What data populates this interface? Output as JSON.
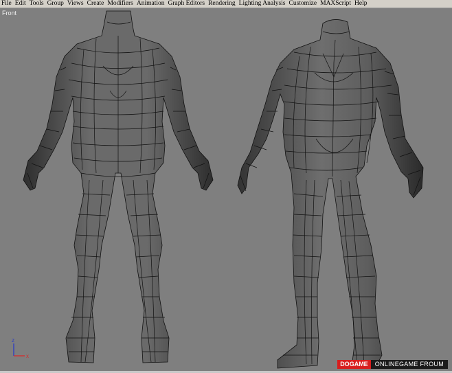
{
  "menu": {
    "items": [
      "File",
      "Edit",
      "Tools",
      "Group",
      "Views",
      "Create",
      "Modifiers",
      "Animation",
      "Graph Editors",
      "Rendering",
      "Lighting Analysis",
      "Customize",
      "MAXScript",
      "Help"
    ]
  },
  "viewport": {
    "label": "Front",
    "axes": {
      "z": "z",
      "x": "x"
    }
  },
  "watermark": {
    "brand": "DOGAME",
    "forum": "ONLINEGAME FROUM"
  },
  "colors": {
    "menubar": "#d4d0c8",
    "viewport_bg": "#7f7f7f",
    "mesh_fill": "#5a5a5a",
    "wire": "#111111",
    "axis_x": "#d03030",
    "axis_z": "#3040c0",
    "brand_red": "#d81e1e"
  }
}
